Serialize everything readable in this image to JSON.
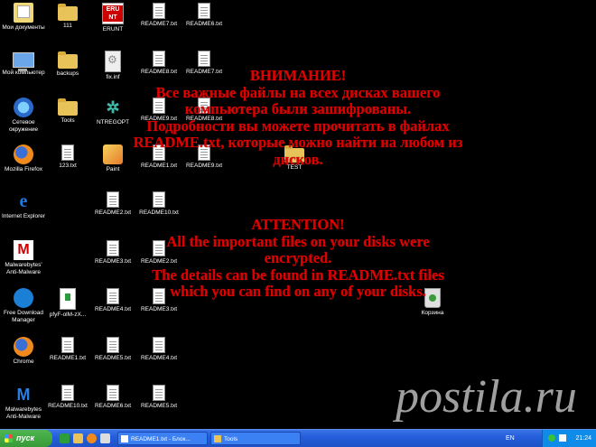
{
  "desktop": {
    "icons": {
      "my_documents": "Мои документы",
      "f111": "111",
      "erunt": "ERUNT",
      "erunt_badge": "ERU NT",
      "readme7_a": "README7.txt",
      "readme6_a": "README6.txt",
      "my_computer": "Мой компьютер",
      "backups": "backups",
      "fix_inf": "fix.inf",
      "readme8_a": "README8.txt",
      "readme7_b": "README7.txt",
      "network": "Сетевое окружение",
      "tools": "Tools",
      "ntregopt": "NTREGOPT",
      "readme9_a": "README9.txt",
      "readme8_b": "README8.txt",
      "firefox": "Mozilla Firefox",
      "txt123": "123.txt",
      "paint": "Paint",
      "readme1_a": "README1.txt",
      "readme9_b": "README9.txt",
      "test": "TEST",
      "ie": "Internet Explorer",
      "readme2_a": "README2.txt",
      "readme10_a": "README10.txt",
      "malwarebytes": "Malwarebytes' Anti-Malware",
      "readme3_a": "README3.txt",
      "readme2_b": "README2.txt",
      "fdm": "Free Download Manager",
      "pfyf": "pfyF-olM-zX...",
      "readme4_a": "README4.txt",
      "readme3_b": "README3.txt",
      "recycle_bin": "Корзина",
      "chrome": "Chrome",
      "readme1_b": "README1.txt",
      "readme5_a": "README5.txt",
      "readme4_b": "README4.txt",
      "mb_anti": "Malwarebytes Anti-Malware",
      "readme10_b": "README10.txt",
      "readme6_b": "README6.txt",
      "readme5_b": "README5.txt"
    },
    "ransom_ru": {
      "line1": "ВНИМАНИЕ!",
      "line2": "Все важные файлы на всех дисках вашего",
      "line3": "компьютера были зашифрованы.",
      "line4": "Подробности вы можете прочитать в файлах",
      "line5": "README.txt, которые можно найти на любом из",
      "line6": "дисков."
    },
    "ransom_en": {
      "line1": "ATTENTION!",
      "line2": "All the important files on your disks were",
      "line3": "encrypted.",
      "line4": "The details can be found in README.txt files",
      "line5": "which you can find on any of your disks."
    },
    "watermark": "postila.ru"
  },
  "taskbar": {
    "start_label": "пуск",
    "tasks": [
      {
        "label": "README1.txt - Блок..."
      },
      {
        "label": "Tools"
      }
    ],
    "lang": "EN",
    "clock": "21:24"
  },
  "colors": {
    "ransom_text": "#e00000",
    "taskbar": "#245edb",
    "start_button": "#379a37"
  }
}
